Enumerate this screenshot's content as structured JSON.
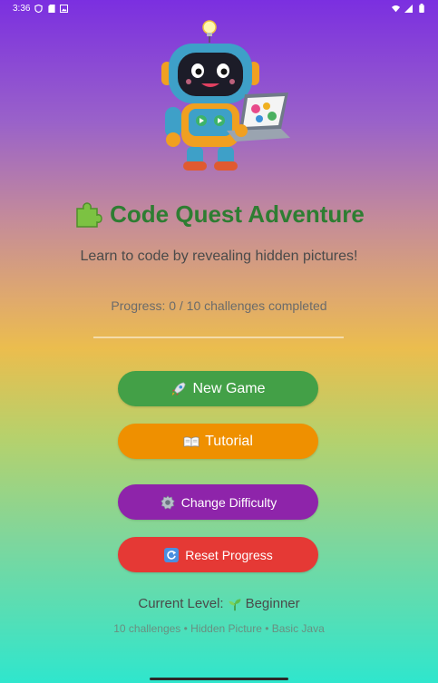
{
  "status_bar": {
    "time": "3:36",
    "left_icons": [
      "shield-icon",
      "sd-card-icon",
      "image-notification-icon"
    ],
    "right_icons": [
      "wifi-icon",
      "signal-icon",
      "battery-icon"
    ]
  },
  "header": {
    "title": "Code Quest Adventure",
    "title_icon": "puzzle-icon",
    "subtitle": "Learn to code by revealing hidden pictures!"
  },
  "progress": {
    "text": "Progress: 0 / 10 challenges completed",
    "completed": 0,
    "total": 10
  },
  "buttons": {
    "new_game": "New Game",
    "tutorial": "Tutorial",
    "change_difficulty": "Change Difficulty",
    "reset_progress": "Reset Progress"
  },
  "level": {
    "label": "Current Level:",
    "value": "Beginner",
    "icon": "seedling-icon"
  },
  "footer_info": "10 challenges • Hidden Picture • Basic Java",
  "colors": {
    "title_green": "#2e7d32",
    "new_game": "#43a047",
    "tutorial": "#ef9000",
    "change_difficulty": "#8e24aa",
    "reset_progress": "#e53935"
  }
}
